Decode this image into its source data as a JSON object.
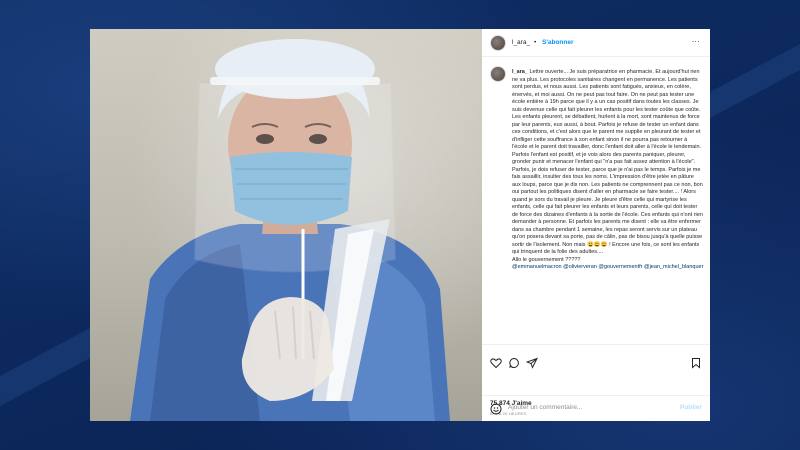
{
  "post": {
    "username": "l_ara_",
    "separator": "•",
    "follow_label": "S'abonner",
    "more_label": "...",
    "caption_username": "l_ara_",
    "caption_text": "Lettre ouverte... Je suis préparatrice en pharmacie. Et aujourd'hui rien ne va plus. Les protocoles sanitaires changent en permanence. Les patients sont perdus, et nous aussi. Les patients sont fatigués, anxieux, en colère, énervés, et moi aussi. On ne peut pas tout faire. On ne peut pas tester une école entière à 19h parce que il y a un cas positif dans toutes les classes. Je suis devenue celle qui fait pleurer les enfants pour les tester coûte que coûte. Les enfants pleurent, se débattent, hurlent à la mort, sont maintenus de force par leur parents, eux aussi, à bout. Parfois je refuse de tester un enfant dans ces conditions, et c'est alors que le parent me supplie en pleurant de tester et d'infliger cette souffrance à son enfant sinon il ne pourra pas retourner à l'école et le parent doit travailler, donc l'enfant doit aller à l'école le lendemain. Parfois l'enfant est positif, et je vois alors des parents paniquer, pleurer, gronder punir et menacer l'enfant qui \"n'a pas fait assez attention à l'école\". Parfois, je dois refuser de tester, parce que je n'ai pas le temps. Parfois je me fais assaillir, insulter des tous les noms. L'impression d'être jetée en pâture aux loups, parce que je dis non. Les patients ne comprennent pas ce non, bon oui partout les politiques disent d'aller en pharmacie se faire tester.... ! Alors quand je sors du travail je pleure. Je pleure d'être celle qui martyrise les enfants, celle qui fait pleurer les enfants et leurs parents, celle qui doit tester de force des dizaines d'enfants à la sortie de l'école. Ces enfants qui n'ont rien demander à personne. Et parfois les parents me disent : elle va être enfermer dans sa chambre pendant 1 semaine, les repas seront servis sur un plateau qu'on posera devant sa porte, pas de câlin, pas de bisou jusqu'à quelle puisse sortir de l'isolement. Non mais 😩😩😩 ! Encore une fois, ce sont les enfants qui trinquent de la folie des adultes....",
    "closing_line": "Allo le gouvernement ?????",
    "mentions": "@emmanuelmacron @olivierveran @gouvernementfr @jean_michel_blanquer",
    "likes": "75 874 J'aime",
    "timestamp": "IL Y A 20 HEURES",
    "comment_placeholder": "Ajouter un commentaire...",
    "publish_label": "Publier"
  },
  "icons": [
    "heart-icon",
    "comment-icon",
    "share-icon",
    "bookmark-icon",
    "emoji-icon",
    "more-icon"
  ],
  "colors": {
    "background": "#0d2a5c",
    "link": "#0095f6",
    "mention": "#00376b",
    "text": "#262626",
    "muted": "#8e8e8e"
  }
}
